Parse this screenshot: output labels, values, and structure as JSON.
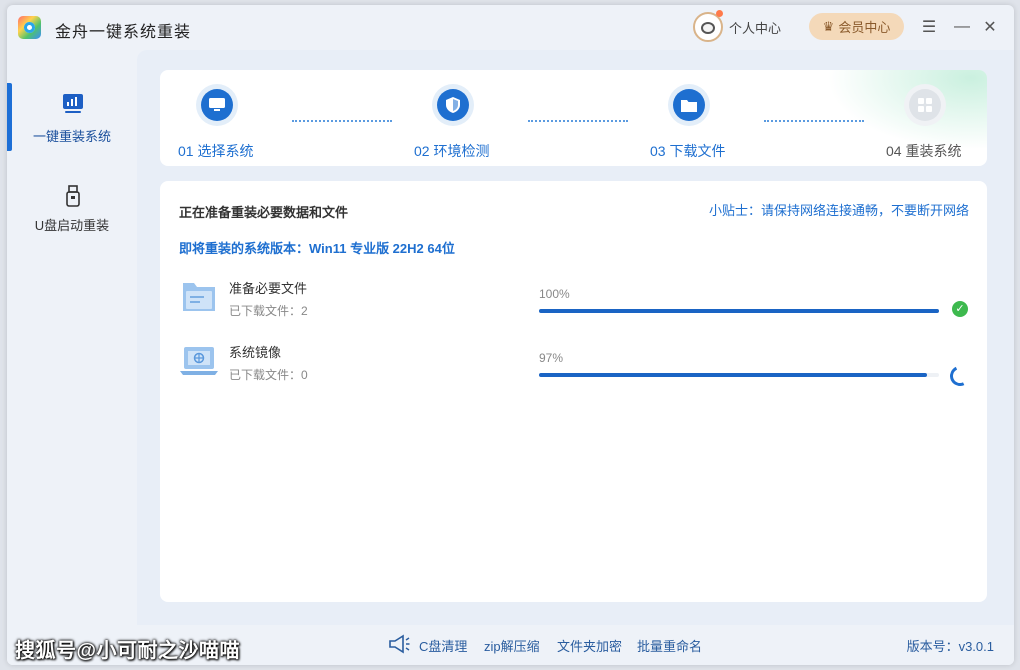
{
  "app": {
    "title": "金舟一键系统重装"
  },
  "header": {
    "profile_label": "个人中心",
    "vip_label": "会员中心"
  },
  "window_controls": {
    "menu": "☰",
    "minimize": "—",
    "close": "✕"
  },
  "sidebar": {
    "items": [
      {
        "label": "一键重装系统",
        "icon": "chart-monitor-icon",
        "active": true
      },
      {
        "label": "U盘启动重装",
        "icon": "usb-drive-icon",
        "active": false
      }
    ]
  },
  "steps": [
    {
      "label": "01 选择系统",
      "icon": "monitor-icon",
      "state": "done"
    },
    {
      "label": "02 环境检测",
      "icon": "shield-icon",
      "state": "done"
    },
    {
      "label": "03 下载文件",
      "icon": "folder-icon",
      "state": "current"
    },
    {
      "label": "04 重装系统",
      "icon": "grid-icon",
      "state": "pending"
    }
  ],
  "content": {
    "heading": "正在准备重装必要数据和文件",
    "tip": "小贴士：请保持网络连接通畅，不要断开网络",
    "version_line": "即将重装的系统版本：Win11 专业版 22H2 64位",
    "tasks": [
      {
        "name": "准备必要文件",
        "sub": "已下载文件：2",
        "percent_label": "100%",
        "progress": 1.0,
        "status": "done"
      },
      {
        "name": "系统镜像",
        "sub": "已下载文件：0",
        "percent_label": "97%",
        "progress": 0.97,
        "status": "loading"
      }
    ]
  },
  "footer": {
    "tools": [
      "C盘清理",
      "zip解压缩",
      "文件夹加密",
      "批量重命名"
    ],
    "version": "版本号：v3.0.1",
    "watermark": "搜狐号@小可耐之沙喵喵"
  },
  "colors": {
    "accent": "#1e6fd0",
    "success": "#3db94e",
    "vip_bg": "#f4d9b9"
  }
}
